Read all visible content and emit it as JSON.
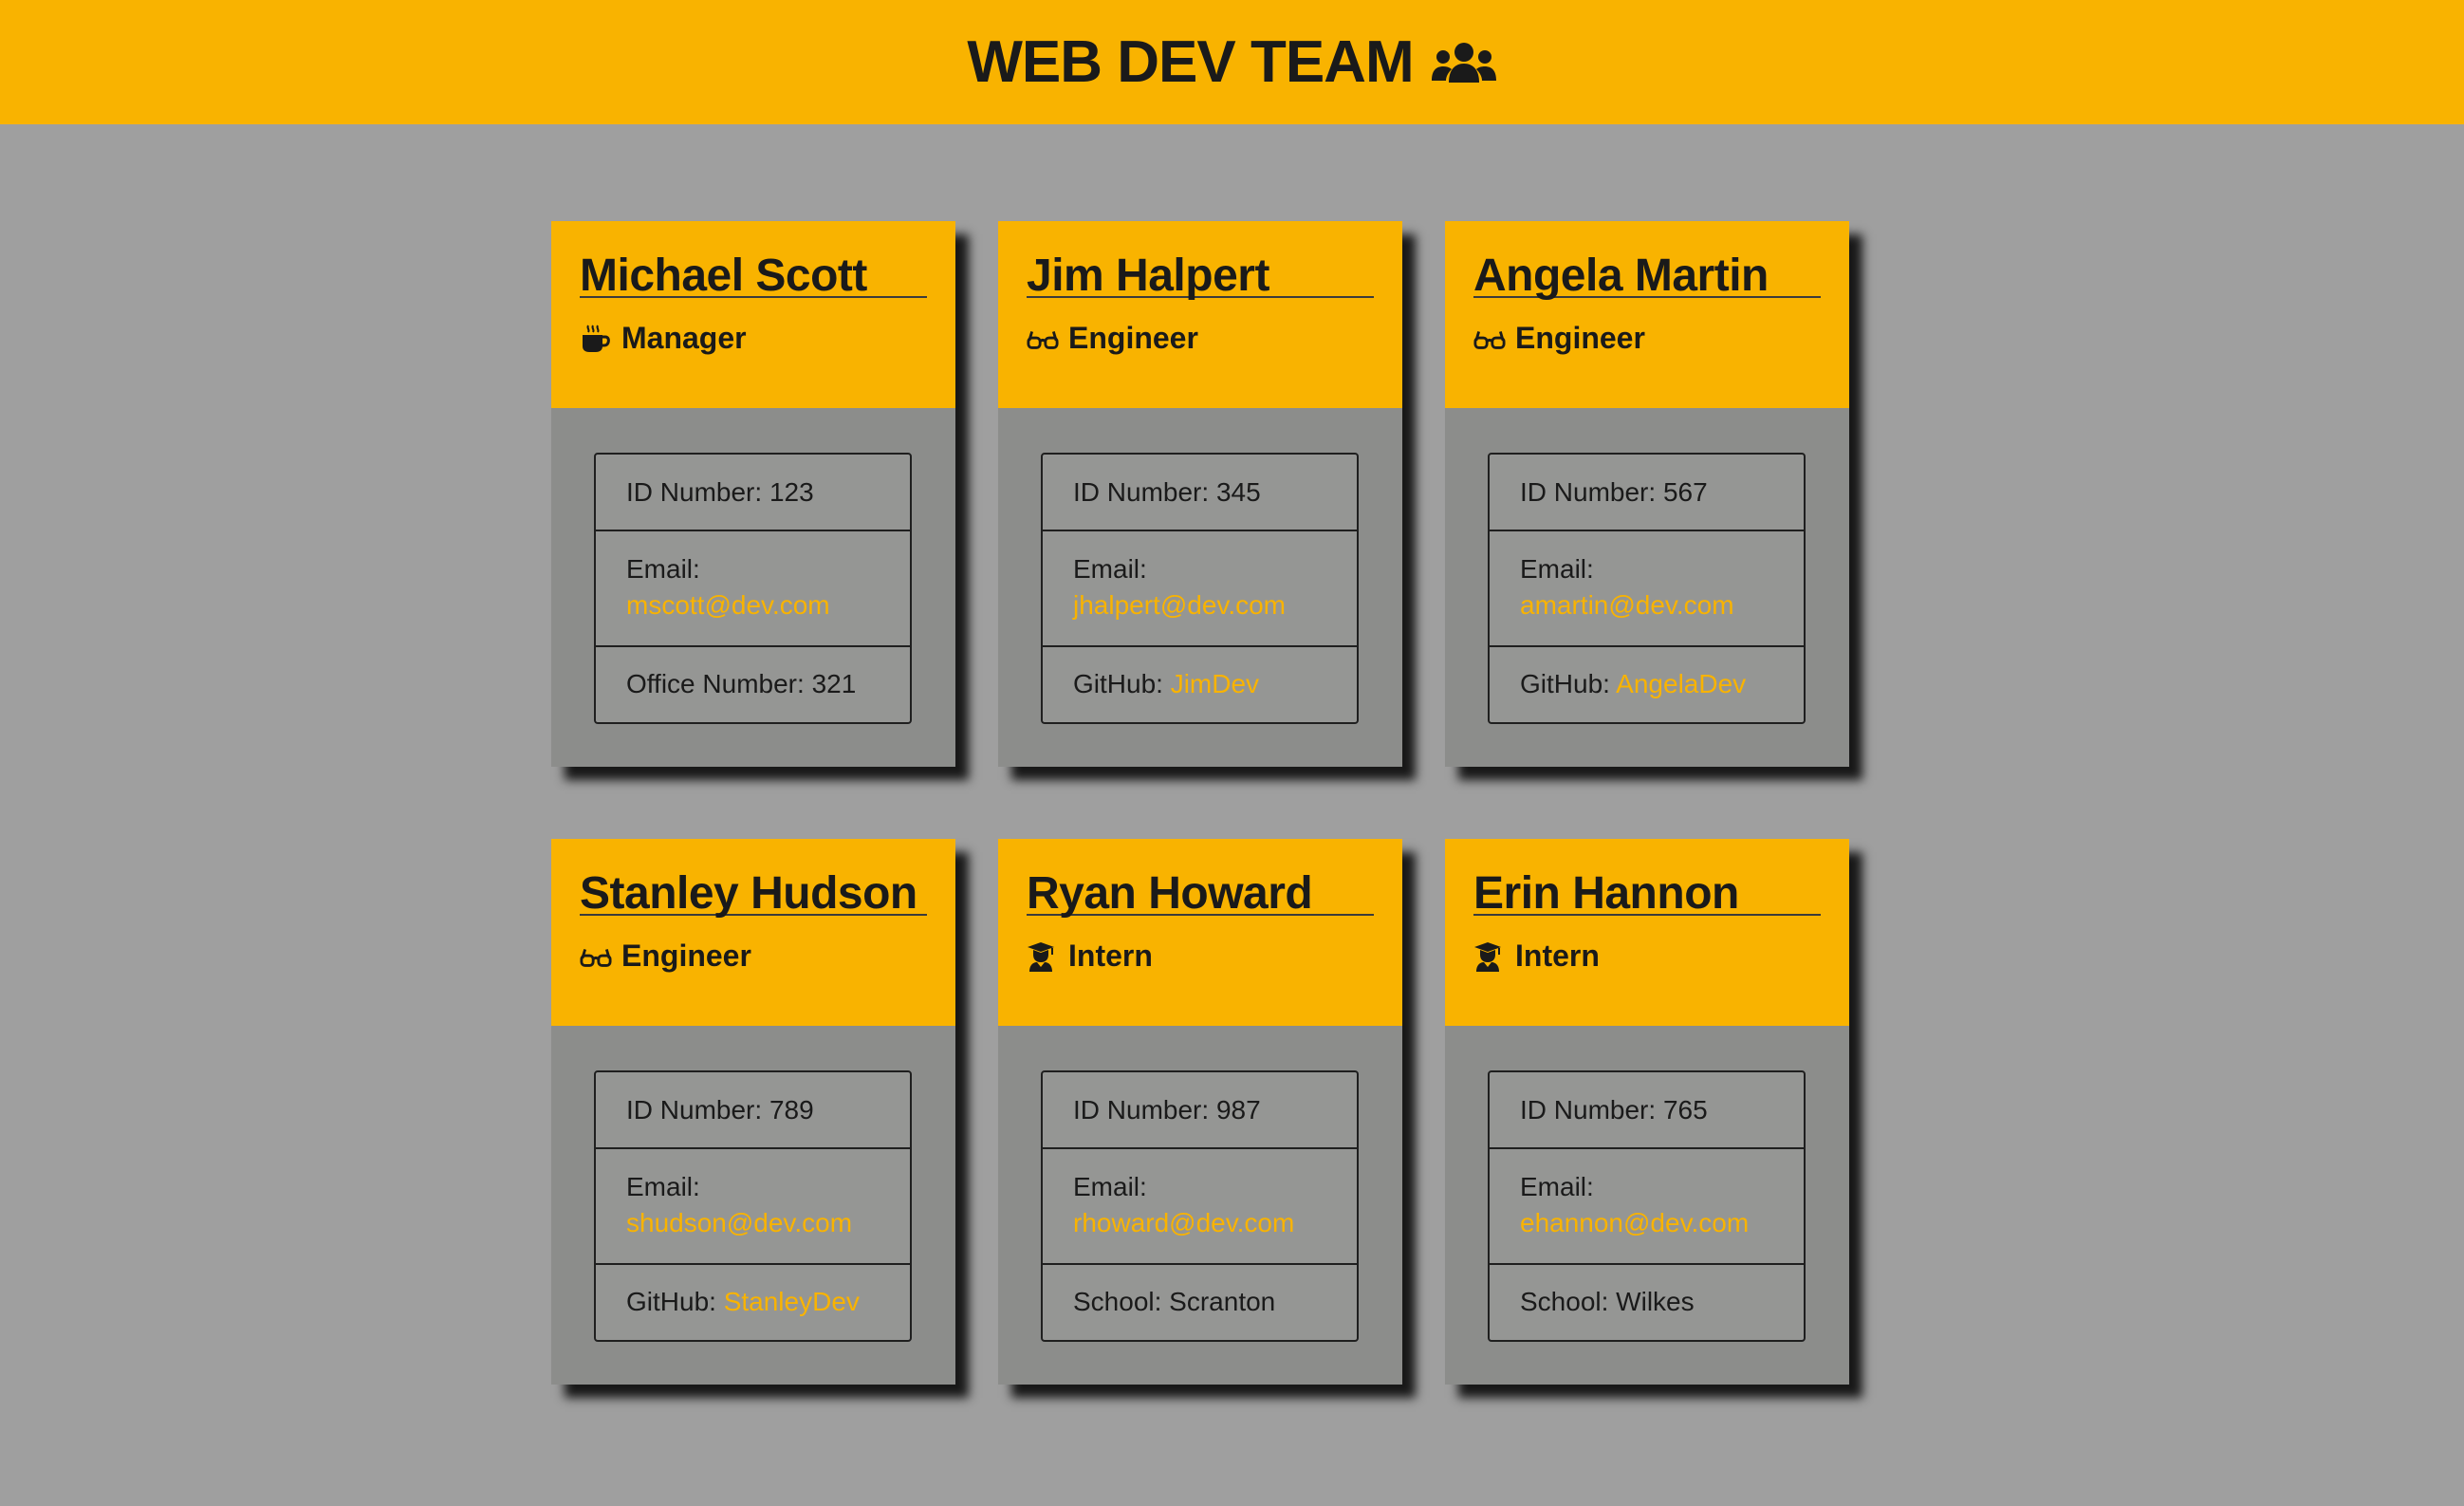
{
  "header": {
    "title": "WEB DEV TEAM",
    "icon": "users-icon"
  },
  "colors": {
    "accent": "#f9b300",
    "background": "#9f9f9f",
    "card_body": "#8c8d8b",
    "text": "#1a1a1a"
  },
  "labels": {
    "id": "ID Number: ",
    "email": "Email:",
    "office": "Office Number: ",
    "github": "GitHub: ",
    "school": "School: "
  },
  "employees": [
    {
      "name": "Michael Scott",
      "role": "Manager",
      "role_icon": "coffee-mug-icon",
      "id": "123",
      "email": "mscott@dev.com",
      "extra_label": "Office Number: ",
      "extra_value": "321",
      "extra_is_link": false
    },
    {
      "name": "Jim Halpert",
      "role": "Engineer",
      "role_icon": "glasses-icon",
      "id": "345",
      "email": "jhalpert@dev.com",
      "extra_label": "GitHub: ",
      "extra_value": "JimDev",
      "extra_is_link": true
    },
    {
      "name": "Angela Martin",
      "role": "Engineer",
      "role_icon": "glasses-icon",
      "id": "567",
      "email": "amartin@dev.com",
      "extra_label": "GitHub: ",
      "extra_value": "AngelaDev",
      "extra_is_link": true
    },
    {
      "name": "Stanley Hudson",
      "role": "Engineer",
      "role_icon": "glasses-icon",
      "id": "789",
      "email": "shudson@dev.com",
      "extra_label": "GitHub: ",
      "extra_value": "StanleyDev",
      "extra_is_link": true
    },
    {
      "name": "Ryan Howard",
      "role": "Intern",
      "role_icon": "graduate-icon",
      "id": "987",
      "email": "rhoward@dev.com",
      "extra_label": "School: ",
      "extra_value": "Scranton",
      "extra_is_link": false
    },
    {
      "name": "Erin Hannon",
      "role": "Intern",
      "role_icon": "graduate-icon",
      "id": "765",
      "email": "ehannon@dev.com",
      "extra_label": "School: ",
      "extra_value": "Wilkes",
      "extra_is_link": false
    }
  ]
}
